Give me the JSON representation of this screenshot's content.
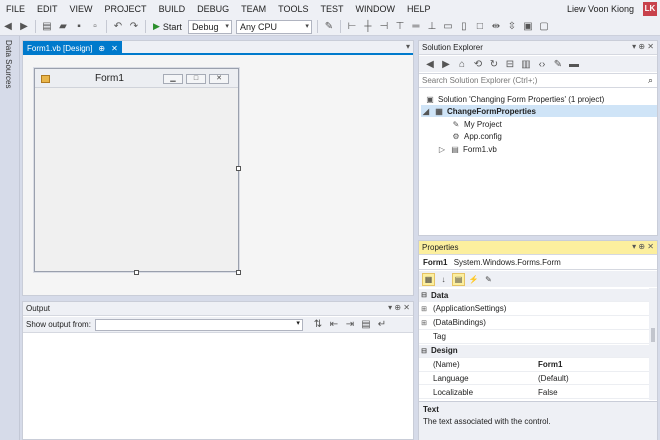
{
  "menubar": {
    "items": [
      "FILE",
      "EDIT",
      "VIEW",
      "PROJECT",
      "BUILD",
      "DEBUG",
      "TEAM",
      "TOOLS",
      "TEST",
      "WINDOW",
      "HELP"
    ],
    "user_name": "Liew Voon Kiong",
    "user_initials": "LK"
  },
  "toolbar": {
    "start_label": "Start",
    "config_value": "Debug",
    "platform_value": "Any CPU"
  },
  "left_strip": {
    "label": "Data Sources"
  },
  "designer": {
    "tab_title": "Form1.vb [Design]",
    "tab_pin": "⊕",
    "tab_close": "✕",
    "form_title": "Form1"
  },
  "output": {
    "title": "Output",
    "show_from_label": "Show output from:",
    "show_from_value": ""
  },
  "solution_explorer": {
    "title": "Solution Explorer",
    "search_placeholder": "Search Solution Explorer (Ctrl+;)",
    "tree": [
      {
        "label": "Solution 'Changing Form Properties' (1 project)",
        "level": 0,
        "icon": "solution-icon"
      },
      {
        "label": "ChangeFormProperties",
        "level": 1,
        "icon": "vb-project-icon",
        "bold": true,
        "selected": true
      },
      {
        "label": "My Project",
        "level": 2,
        "icon": "wrench-icon"
      },
      {
        "label": "App.config",
        "level": 2,
        "icon": "config-icon"
      },
      {
        "label": "Form1.vb",
        "level": 2,
        "icon": "form-icon"
      }
    ]
  },
  "properties": {
    "title": "Properties",
    "object_name": "Form1",
    "object_type": "System.Windows.Forms.Form",
    "rows": [
      {
        "type": "category",
        "name": "Data"
      },
      {
        "type": "prop",
        "name": "(ApplicationSettings)",
        "value": "",
        "expandable": true
      },
      {
        "type": "prop",
        "name": "(DataBindings)",
        "value": "",
        "expandable": true
      },
      {
        "type": "prop",
        "name": "Tag",
        "value": ""
      },
      {
        "type": "category",
        "name": "Design"
      },
      {
        "type": "prop",
        "name": "(Name)",
        "value": "Form1",
        "bold": true
      },
      {
        "type": "prop",
        "name": "Language",
        "value": "(Default)"
      },
      {
        "type": "prop",
        "name": "Localizable",
        "value": "False"
      }
    ],
    "desc_title": "Text",
    "desc_text": "The text associated with the control."
  },
  "colors": {
    "accent": "#007acc",
    "active_header": "#fcef9e",
    "avatar": "#c8414b"
  }
}
